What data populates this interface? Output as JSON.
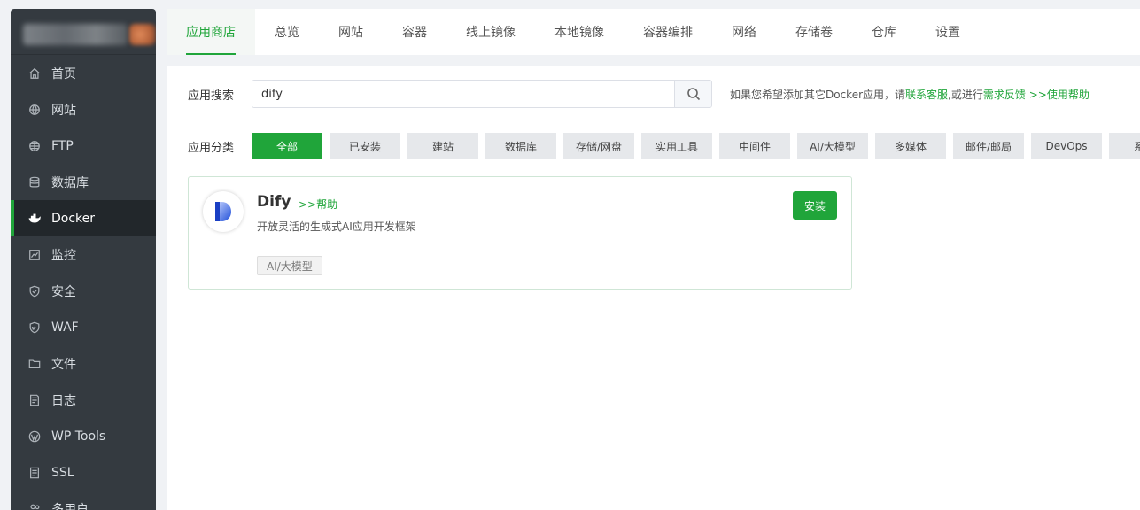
{
  "sidebar": {
    "items": [
      {
        "label": "首页",
        "icon": "home-icon"
      },
      {
        "label": "网站",
        "icon": "globe-icon"
      },
      {
        "label": "FTP",
        "icon": "ftp-globe-icon"
      },
      {
        "label": "数据库",
        "icon": "database-icon"
      },
      {
        "label": "Docker",
        "icon": "docker-icon",
        "active": true
      },
      {
        "label": "监控",
        "icon": "monitor-icon"
      },
      {
        "label": "安全",
        "icon": "shield-icon"
      },
      {
        "label": "WAF",
        "icon": "waf-shield-icon"
      },
      {
        "label": "文件",
        "icon": "folder-icon"
      },
      {
        "label": "日志",
        "icon": "log-icon"
      },
      {
        "label": "WP Tools",
        "icon": "wordpress-icon"
      },
      {
        "label": "SSL",
        "icon": "ssl-icon"
      },
      {
        "label": "多用户",
        "icon": "users-icon"
      }
    ]
  },
  "tabs": [
    "应用商店",
    "总览",
    "网站",
    "容器",
    "线上镜像",
    "本地镜像",
    "容器编排",
    "网络",
    "存储卷",
    "仓库",
    "设置"
  ],
  "search": {
    "label": "应用搜索",
    "value": "dify",
    "hint_prefix": "如果您希望添加其它Docker应用，请",
    "hint_link1": "联系客服",
    "hint_middle": ",或进行",
    "hint_link2": "需求反馈",
    "hint_link3": ">>使用帮助"
  },
  "categories": {
    "label": "应用分类",
    "items": [
      "全部",
      "已安装",
      "建站",
      "数据库",
      "存储/网盘",
      "实用工具",
      "中间件",
      "AI/大模型",
      "多媒体",
      "邮件/邮局",
      "DevOps",
      "系统"
    ]
  },
  "app": {
    "name": "Dify",
    "help": ">>帮助",
    "desc": "开放灵活的生成式AI应用开发框架",
    "tag": "AI/大模型",
    "install": "安装"
  },
  "colors": {
    "accent": "#20a53a",
    "sidebar_bg": "#343a40"
  }
}
